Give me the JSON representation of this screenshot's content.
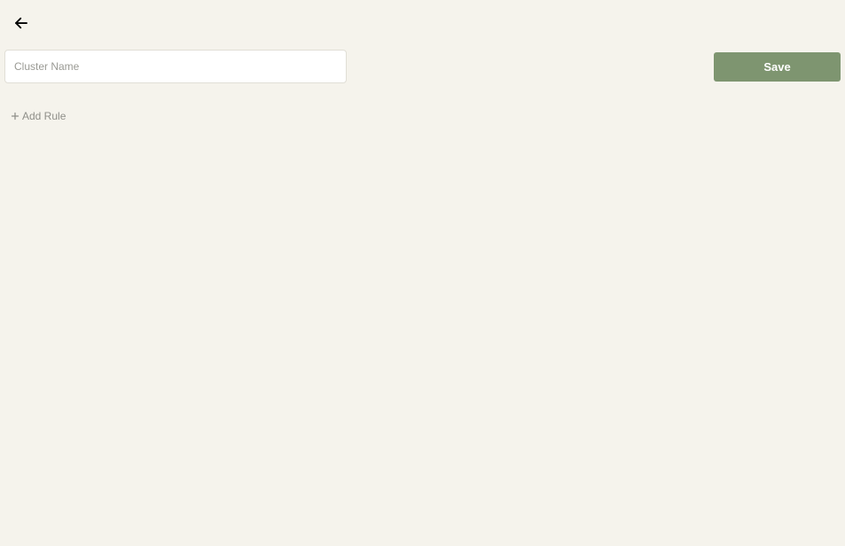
{
  "header": {
    "save_label": "Save"
  },
  "form": {
    "cluster_name_placeholder": "Cluster Name",
    "cluster_name_value": ""
  },
  "actions": {
    "add_rule_label": "Add Rule"
  }
}
